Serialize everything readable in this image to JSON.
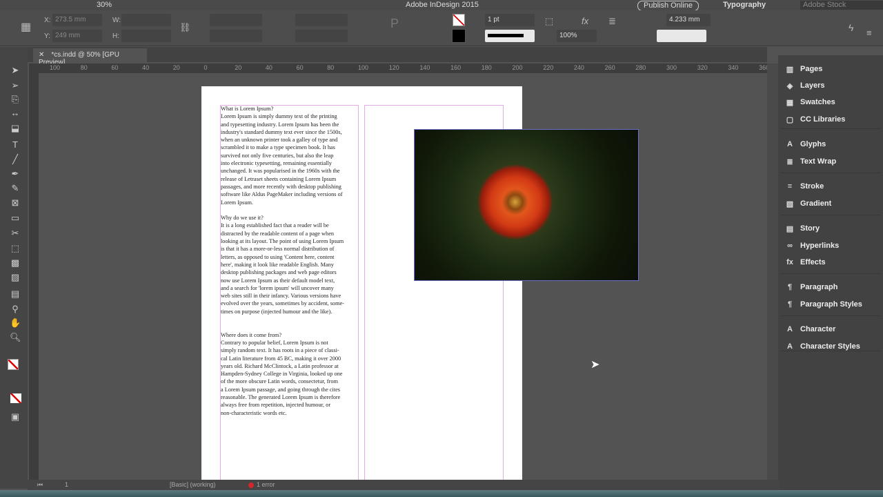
{
  "appbar": {
    "zoom": "30%",
    "title": "Adobe InDesign 2015",
    "publish": "Publish Online",
    "workspace": "Typography",
    "search_placeholder": "Adobe Stock"
  },
  "control": {
    "x_label": "X:",
    "x_value": "273.5 mm",
    "y_label": "Y:",
    "y_value": "249 mm",
    "w_label": "W:",
    "h_label": "H:",
    "stroke_weight": "1 pt",
    "opacity": "100%",
    "offset": "4.233 mm"
  },
  "tab": {
    "title": "*cs.indd @ 50% [GPU Preview]"
  },
  "ruler": [
    "100",
    "80",
    "60",
    "40",
    "20",
    "0",
    "20",
    "40",
    "60",
    "80",
    "100",
    "120",
    "140",
    "160",
    "180",
    "200",
    "220",
    "240",
    "260",
    "280",
    "300",
    "320",
    "340",
    "360"
  ],
  "document": {
    "lines": [
      "What is Lorem Ipsum?",
      "Lorem Ipsum is simply dummy text of the printing",
      "and typesetting industry. Lorem Ipsum has been the",
      "industry's standard dummy text ever since the 1500s,",
      "when an unknown printer took a galley of type and",
      "scrambled it to make a type specimen book. It has",
      "survived not only five centuries, but also the leap",
      "into electronic typesetting, remaining essentially",
      "unchanged. It was popularised in the 1960s with the",
      "release of Letraset sheets containing Lorem Ipsum",
      "passages, and more recently with desktop publishing",
      "software like Aldus PageMaker including versions of",
      "Lorem Ipsum.",
      "",
      "Why do we use it?",
      "It is a long established fact that a reader will be",
      "distracted by the readable content of a page when",
      "looking at its layout. The point of using Lorem Ipsum",
      "is that it has a more-or-less normal distribution of",
      "letters, as opposed to using 'Content here, content",
      "here', making it look like readable English. Many",
      "desktop publishing packages and web page editors",
      "now use Lorem Ipsum as their default model text,",
      "and a search for 'lorem ipsum' will uncover many",
      "web sites still in their infancy. Various versions have",
      "evolved over the years, sometimes by accident, some-",
      "times on purpose (injected humour and the like).",
      "",
      "",
      "Where does it come from?",
      "Contrary to popular belief, Lorem Ipsum is not",
      "simply random text. It has roots in a piece of classi-",
      "cal Latin literature from 45 BC, making it over 2000",
      "years old. Richard McClintock, a Latin professor at",
      "Hampden-Sydney College in Virginia, looked up one",
      "of the more obscure Latin words, consectetur, from",
      "a Lorem Ipsum passage, and going through the cites",
      "reasonable. The generated Lorem Ipsum is therefore",
      "always free from repetition, injected humour, or",
      "non-characteristic words etc."
    ]
  },
  "panels": [
    {
      "label": "Pages",
      "icon": "pages-icon",
      "glyph": "▥"
    },
    {
      "label": "Layers",
      "icon": "layers-icon",
      "glyph": "◈"
    },
    {
      "label": "Swatches",
      "icon": "swatches-icon",
      "glyph": "▦"
    },
    {
      "label": "CC Libraries",
      "icon": "cc-libraries-icon",
      "glyph": "▢"
    },
    {
      "label": "Glyphs",
      "icon": "glyphs-icon",
      "glyph": "A"
    },
    {
      "label": "Text Wrap",
      "icon": "text-wrap-icon",
      "glyph": "≣"
    },
    {
      "label": "Stroke",
      "icon": "stroke-icon",
      "glyph": "≡"
    },
    {
      "label": "Gradient",
      "icon": "gradient-icon",
      "glyph": "▧"
    },
    {
      "label": "Story",
      "icon": "story-icon",
      "glyph": "▤"
    },
    {
      "label": "Hyperlinks",
      "icon": "hyperlinks-icon",
      "glyph": "∞"
    },
    {
      "label": "Effects",
      "icon": "effects-icon",
      "glyph": "fx"
    },
    {
      "label": "Paragraph",
      "icon": "paragraph-icon",
      "glyph": "¶"
    },
    {
      "label": "Paragraph Styles",
      "icon": "paragraph-styles-icon",
      "glyph": "¶"
    },
    {
      "label": "Character",
      "icon": "character-icon",
      "glyph": "A"
    },
    {
      "label": "Character Styles",
      "icon": "character-styles-icon",
      "glyph": "A"
    }
  ],
  "status": {
    "page": "1",
    "style": "[Basic] (working)",
    "errors": "1 error"
  },
  "colors": {
    "error": "#d0282c",
    "frame_guide": "#e3a9e8",
    "selection": "#6a6fd0"
  }
}
